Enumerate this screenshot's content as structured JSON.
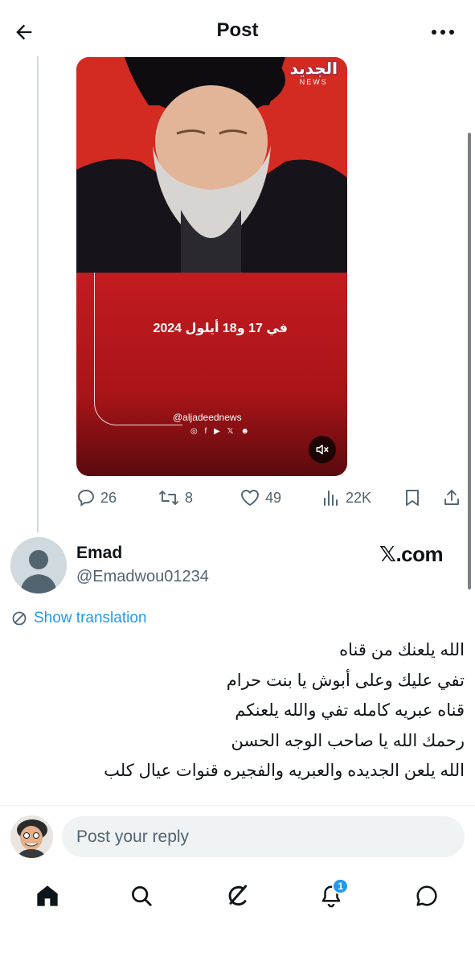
{
  "header": {
    "title": "Post"
  },
  "video": {
    "channel_logo": "الجديد",
    "channel_logo_sub": "NEWS",
    "date_text": "في 17 و18 أيلول 2024",
    "handle": "@aljadeednews",
    "social_icons": "◎ f ▶ 𝕏 ☻"
  },
  "actions": {
    "replies": "26",
    "reposts": "8",
    "likes": "49",
    "views": "22K"
  },
  "reply": {
    "name": "Emad",
    "handle": "@Emadwou01234",
    "brand_text": "𝕏.com",
    "show_translation": "Show translation",
    "lines": [
      "الله يلعنك من قناه",
      "تفي عليك وعلى أبوش يا بنت حرام",
      "قناه عبريه كامله تفي والله يلعنكم",
      "رحمك الله يا صاحب الوجه الحسن",
      "الله يلعن الجديده والعبريه والفجيره قنوات عيال كلب"
    ]
  },
  "composer": {
    "placeholder": "Post your reply"
  },
  "tabbar": {
    "notifications_badge": "1"
  },
  "colors": {
    "accent": "#1d9bf0",
    "muted": "#536471",
    "text": "#0f1419",
    "video_red": "#c31b20"
  }
}
